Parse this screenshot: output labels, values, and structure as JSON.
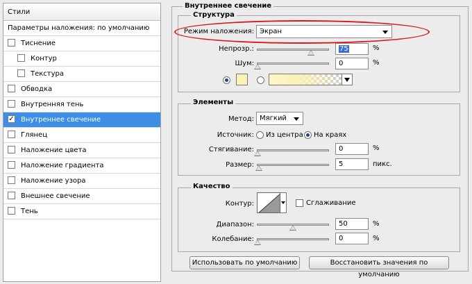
{
  "sidebar": {
    "header": "Стили",
    "blending_options": "Параметры наложения: по умолчанию",
    "items": [
      {
        "label": "Тиснение",
        "checked": false,
        "sub": false
      },
      {
        "label": "Контур",
        "checked": false,
        "sub": true
      },
      {
        "label": "Текстура",
        "checked": false,
        "sub": true
      },
      {
        "label": "Обводка",
        "checked": false,
        "sub": false
      },
      {
        "label": "Внутренняя тень",
        "checked": false,
        "sub": false
      },
      {
        "label": "Внутреннее свечение",
        "checked": true,
        "sub": false
      },
      {
        "label": "Глянец",
        "checked": false,
        "sub": false
      },
      {
        "label": "Наложение цвета",
        "checked": false,
        "sub": false
      },
      {
        "label": "Наложение градиента",
        "checked": false,
        "sub": false
      },
      {
        "label": "Наложение узора",
        "checked": false,
        "sub": false
      },
      {
        "label": "Внешнее свечение",
        "checked": false,
        "sub": false
      },
      {
        "label": "Тень",
        "checked": false,
        "sub": false
      }
    ],
    "selected_color": "#3d8ee4"
  },
  "panel": {
    "title": "Внутреннее свечение",
    "structure": {
      "title": "Структура",
      "blend_mode_label": "Режим наложения:",
      "blend_mode_value": "Экран",
      "opacity_label": "Непрозр.:",
      "opacity_value": "75",
      "opacity_unit": "%",
      "opacity_fraction": 0.75,
      "noise_label": "Шум:",
      "noise_value": "0",
      "noise_unit": "%",
      "noise_fraction": 0,
      "color_swatch": "#fbf3b6"
    },
    "elements": {
      "title": "Элементы",
      "technique_label": "Метод:",
      "technique_value": "Мягкий",
      "source_label": "Источник:",
      "source_center": "Из центра",
      "source_edge": "На краях",
      "choke_label": "Стягивание:",
      "choke_value": "0",
      "choke_unit": "%",
      "choke_fraction": 0,
      "size_label": "Размер:",
      "size_value": "5",
      "size_unit": "пикс.",
      "size_fraction": 0.02
    },
    "quality": {
      "title": "Качество",
      "contour_label": "Контур:",
      "antialias_label": "Сглаживание",
      "range_label": "Диапазон:",
      "range_value": "50",
      "range_unit": "%",
      "range_fraction": 0.5,
      "jitter_label": "Колебание:",
      "jitter_value": "0",
      "jitter_unit": "%",
      "jitter_fraction": 0
    },
    "buttons": {
      "make_default": "Использовать по умолчанию",
      "reset_default": "Восстановить значения по умолчанию"
    }
  },
  "annotation_color": "#d81a1a"
}
